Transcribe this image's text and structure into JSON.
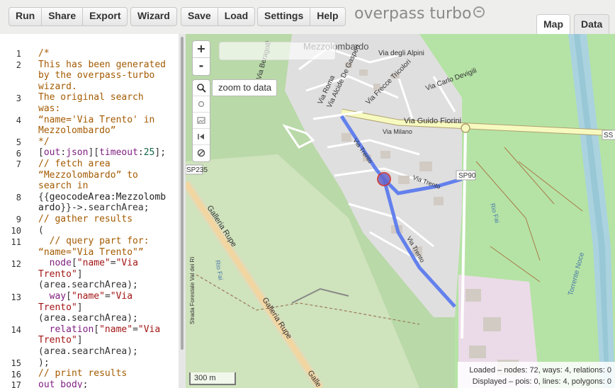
{
  "toolbar": {
    "run": "Run",
    "share": "Share",
    "export": "Export",
    "wizard": "Wizard",
    "save": "Save",
    "load": "Load",
    "settings": "Settings",
    "help": "Help"
  },
  "logo": "overpass turbo",
  "tabs": {
    "map": "Map",
    "data": "Data"
  },
  "editor": {
    "line_numbers": [
      "1",
      "2",
      "3",
      "4",
      "5",
      "6",
      "7",
      "8",
      "9",
      "10",
      "11",
      "12",
      "13",
      "14",
      "15",
      "16",
      "17"
    ]
  },
  "map": {
    "zoom_in": "+",
    "zoom_out": "-",
    "tooltip": "zoom to data",
    "scale": "300 m",
    "place_label": "Mezzolombardo",
    "streets": {
      "via_degli_alpini": "Via degli Alpini",
      "via_trecce_tricolori": "Via Frecce Tricolori",
      "via_carlo_devigili": "Via Carlo Devigili",
      "via_alcide": "Via Alcide De Gasperi",
      "via_roma": "Via Roma",
      "via_beragolli": "Via Beragolli",
      "via_guido_fiorini": "Via Guido Fiorini",
      "via_milano": "Via Milano",
      "via_trento_1": "Via Trento",
      "via_trento_2": "Via Trento",
      "via_trento_3": "Via Trento",
      "sp90": "SP90",
      "sp235": "SP235",
      "ss": "SS",
      "galleria_1": "Galleria Rupe",
      "galleria_2": "Galleria Rupe",
      "galleria_3": "Galle",
      "rio_fai_1": "Rio Fai",
      "rio_fai_2": "Rio Fai",
      "torrente_noce": "Torrente Noce",
      "strada_forestale": "Strada Forestale Val dei Rì"
    },
    "stats_loaded": "Loaded – nodes: 72, ways: 4, relations: 0",
    "stats_displayed": "Displayed – pois: 0, lines: 4, polygons: 0"
  },
  "colors": {
    "route": "#5577ee",
    "forest": "#add19e",
    "water": "#aad3df",
    "urban": "#e0dfdf"
  }
}
